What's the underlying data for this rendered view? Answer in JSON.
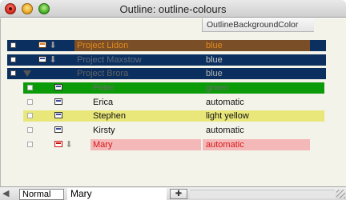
{
  "window": {
    "title": "Outline: outline-colours"
  },
  "table": {
    "column_header": "OutlineBackgroundColor",
    "rows": [
      {
        "name": "Project Lidon",
        "value": "blue",
        "bar_color": "#0b2f5e",
        "tint_color": "#7a4f27",
        "name_color": "#e08a1e",
        "value_color": "#e08a1e",
        "indent": 0,
        "icon": "orange",
        "has_arrow": true,
        "has_triangle": false,
        "tinted": true
      },
      {
        "name": "Project Maxstow",
        "value": "blue",
        "bar_color": "#0b2f5e",
        "tint_color": "#0b2f5e",
        "name_color": "#5d6b7e",
        "value_color": "#c8c8c8",
        "indent": 0,
        "icon": "blue",
        "has_arrow": true,
        "has_triangle": false,
        "tinted": false
      },
      {
        "name": "Project Brora",
        "value": "blue",
        "bar_color": "#0b2f5e",
        "tint_color": "#0b2f5e",
        "name_color": "#646464",
        "value_color": "#b5b5b5",
        "indent": 0,
        "icon": "none",
        "has_arrow": false,
        "has_triangle": true,
        "tinted": false
      },
      {
        "name": "Peter",
        "value": "green",
        "bar_color": "#0b9a08",
        "tint_color": "#0b9a08",
        "name_color": "#6b6b6b",
        "value_color": "#6b6b6b",
        "indent": 1,
        "icon": "blue",
        "has_arrow": false,
        "has_triangle": false,
        "tinted": false
      },
      {
        "name": "Erica",
        "value": "automatic",
        "bar_color": "",
        "tint_color": "",
        "name_color": "#111111",
        "value_color": "#111111",
        "indent": 1,
        "icon": "blue",
        "has_arrow": false,
        "has_triangle": false,
        "tinted": false
      },
      {
        "name": "Stephen",
        "value": "light yellow",
        "bar_color": "#e9e77a",
        "tint_color": "#e9e77a",
        "name_color": "#111111",
        "value_color": "#111111",
        "indent": 1,
        "icon": "blue",
        "has_arrow": false,
        "has_triangle": false,
        "tinted": false
      },
      {
        "name": "Kirsty",
        "value": "automatic",
        "bar_color": "",
        "tint_color": "",
        "name_color": "#111111",
        "value_color": "#111111",
        "indent": 1,
        "icon": "blue",
        "has_arrow": false,
        "has_triangle": false,
        "tinted": false
      },
      {
        "name": "Mary",
        "value": "automatic",
        "bar_color": "#f4b8b8",
        "tint_color": "#f4b8b8",
        "name_color": "#d81818",
        "value_color": "#d81818",
        "indent": 1,
        "icon": "red",
        "has_arrow": true,
        "has_triangle": false,
        "tinted": false
      }
    ]
  },
  "bottom_bar": {
    "style_label": "Normal",
    "edit_value": "Mary",
    "left_arrow_icon": "left-arrow-icon",
    "button_icon": "insert-icon"
  }
}
